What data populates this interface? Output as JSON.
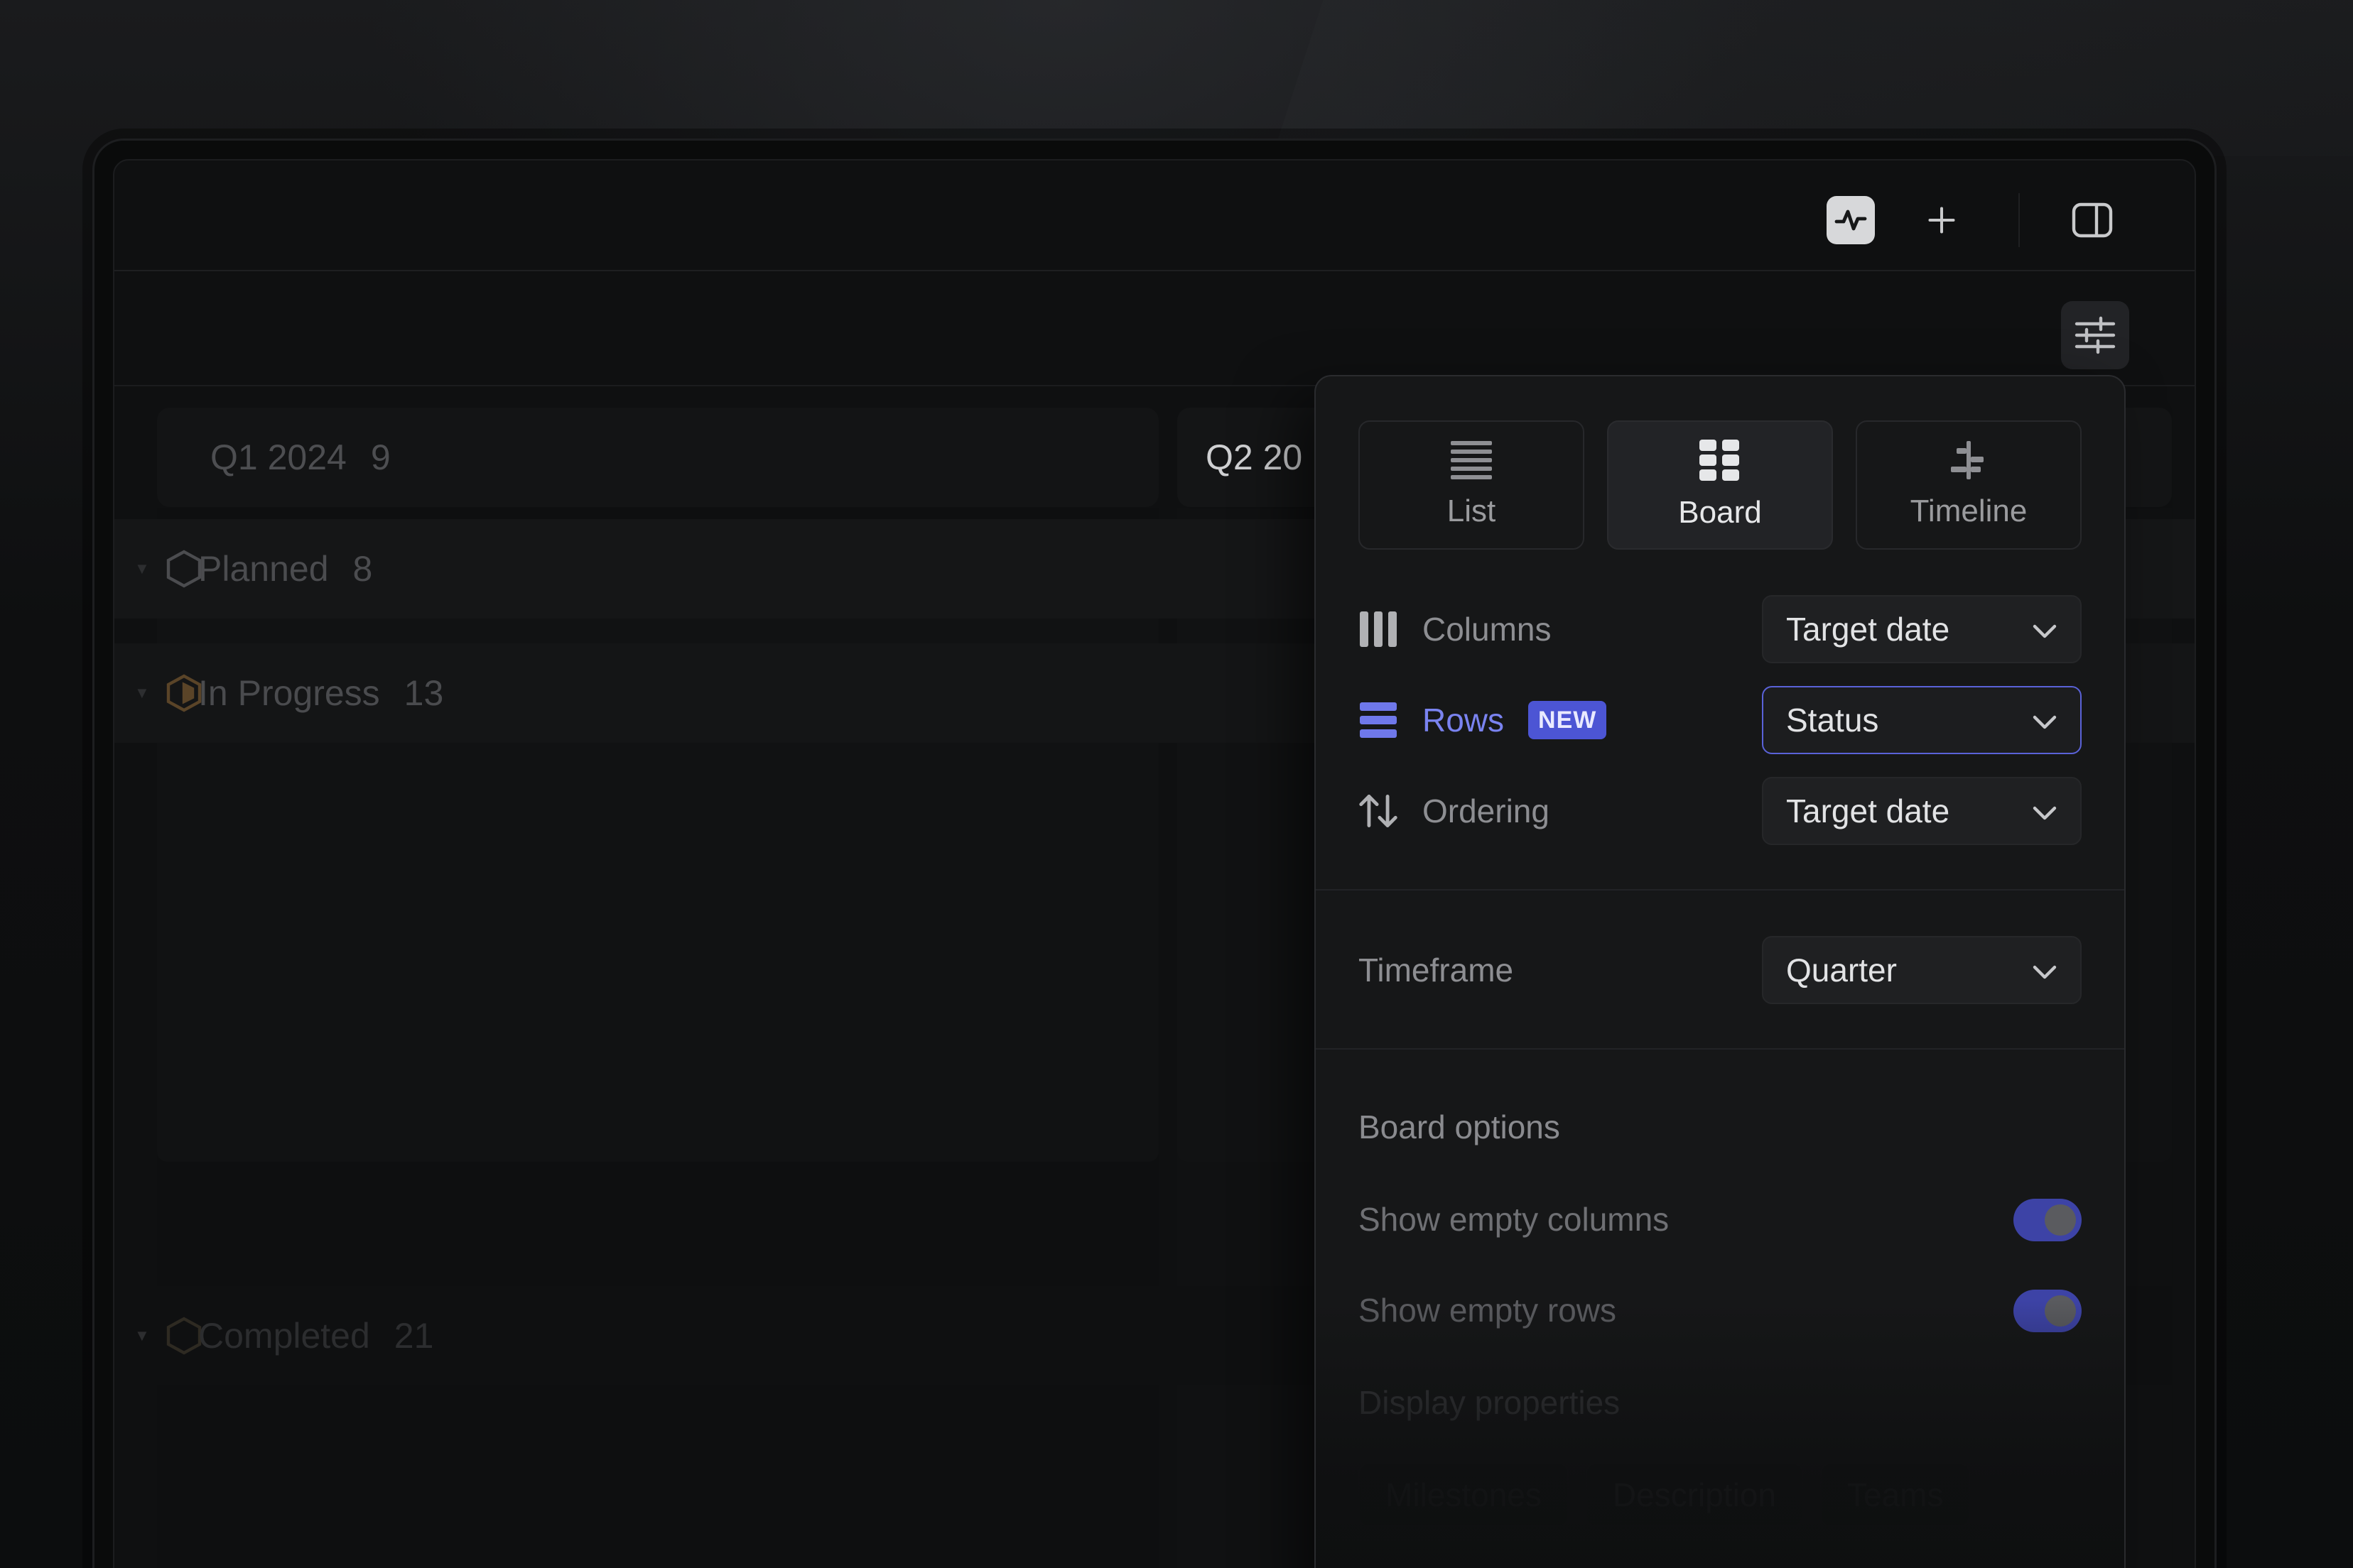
{
  "columns": {
    "q1": {
      "label": "Q1 2024",
      "count": "9"
    },
    "q2": {
      "label": "Q2 20"
    }
  },
  "groups": {
    "planned": {
      "label": "Planned",
      "count": "8"
    },
    "in_progress": {
      "label": "In Progress",
      "count": "13"
    },
    "completed": {
      "label": "Completed",
      "count": "21"
    }
  },
  "popover": {
    "layouts": [
      {
        "label": "List",
        "icon": "list-icon"
      },
      {
        "label": "Board",
        "icon": "board-icon",
        "selected": true
      },
      {
        "label": "Timeline",
        "icon": "timeline-icon"
      }
    ],
    "columns": {
      "label": "Columns",
      "value": "Target date",
      "icon": "columns-icon"
    },
    "rows": {
      "label": "Rows",
      "badge": "NEW",
      "value": "Status",
      "icon": "rows-icon"
    },
    "ordering": {
      "label": "Ordering",
      "value": "Target date",
      "icon": "sort-arrows-icon"
    },
    "timeframe": {
      "label": "Timeframe",
      "value": "Quarter"
    },
    "board_options": {
      "title": "Board options",
      "show_empty_columns": {
        "label": "Show empty columns",
        "on": true
      },
      "show_empty_rows": {
        "label": "Show empty rows",
        "on": true
      }
    },
    "display_properties": {
      "title": "Display properties",
      "chips": [
        "Milestones",
        "Description",
        "Teams"
      ]
    }
  },
  "colors": {
    "accent": "#5e6ad2",
    "badge": "#4c55d4",
    "toggle": "#3d43a6"
  }
}
